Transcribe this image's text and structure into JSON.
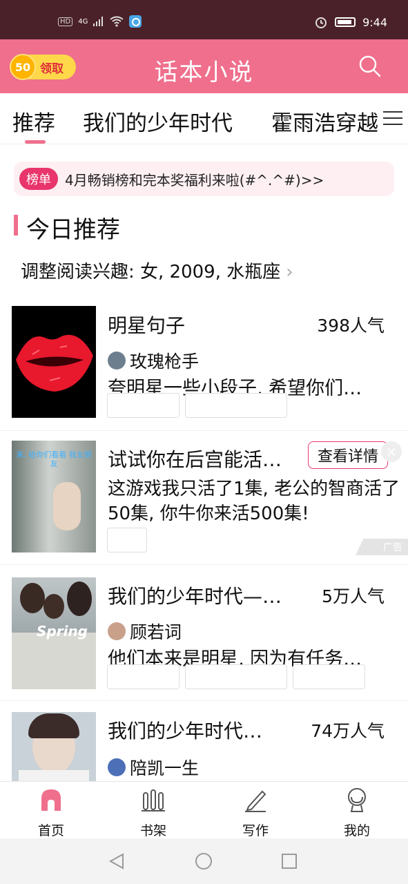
{
  "status_bar": {
    "left_badges": [
      "HD",
      "4G"
    ],
    "time": "9:44"
  },
  "header": {
    "coin_value": "50",
    "coin_label": "领取",
    "title": "话本小说",
    "search_icon": "search-icon"
  },
  "tabs": [
    {
      "label": "推荐",
      "active": true
    },
    {
      "label": "我们的少年时代"
    },
    {
      "label": "霍雨浩穿越"
    }
  ],
  "notice": {
    "badge": "榜单",
    "text": "4月畅销榜和完本奖福利来啦(#^.^#)>>"
  },
  "section": {
    "title": "今日推荐",
    "interest": "调整阅读兴趣: 女, 2009, 水瓶座"
  },
  "books": [
    {
      "title": "明星句子",
      "popularity": "398人气",
      "author": "玫瑰枪手",
      "desc": "夸明星一些小段子, 希望你们…"
    },
    {
      "title": "我们的少年时代—…",
      "popularity": "5万人气",
      "author": "顾若词",
      "desc": "他们本来是明星, 因为有任务…"
    },
    {
      "title": "我们的少年时代…",
      "popularity": "74万人气",
      "author": "陪凯一生",
      "desc": ""
    }
  ],
  "ad": {
    "title": "试试你在后宫能活…",
    "detail_button": "查看详情",
    "desc": "这游戏我只活了1集, 老公的智商活了50集, 你牛你来活500集!",
    "cover_caption": "来, 给你们看看 我女朋友",
    "label": "广告"
  },
  "cover_text": {
    "spring": "Spring"
  },
  "bottom_nav": [
    {
      "label": "首页",
      "icon": "home-icon",
      "active": true
    },
    {
      "label": "书架",
      "icon": "bookshelf-icon"
    },
    {
      "label": "写作",
      "icon": "pen-icon"
    },
    {
      "label": "我的",
      "icon": "profile-icon"
    }
  ],
  "colors": {
    "brand": "#ef6f8c",
    "status_bar": "#4a2128",
    "badge": "#e8356b"
  }
}
